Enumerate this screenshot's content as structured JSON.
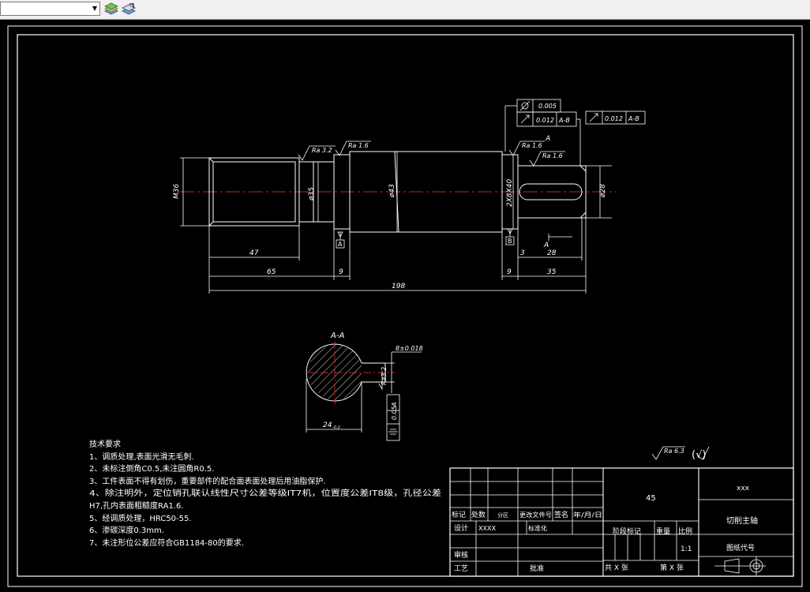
{
  "toolbar": {
    "layer_combo_value": "",
    "icons": [
      "layer-stack-icon",
      "layer-properties-icon"
    ]
  },
  "drawing": {
    "colors": {
      "background": "#000000",
      "line": "#ffffff",
      "center_line": "#ff3333"
    },
    "dims": {
      "m36": "M36",
      "d35": "ø35",
      "d43": "ø43",
      "spline": "2X8X40",
      "d28": "ø28",
      "l47": "47",
      "l65": "65",
      "l9a": "9",
      "l198": "198",
      "l9b": "9",
      "l35": "35",
      "l3": "3",
      "l28": "28"
    },
    "roughness": {
      "ra32": "Ra 3.2",
      "ra16a": "Ra 1.6",
      "ra16b": "Ra 1.6",
      "ra16c": "Ra 1.6",
      "ra63": "Ra 6.3",
      "ra32b": "Ra3.2"
    },
    "tolerances": {
      "runout1": "0.005",
      "runout2": "0.012",
      "datum_ab": "A-B",
      "runout3": "0.012",
      "datum_ab2": "A-B"
    },
    "labels": {
      "datum_a": "A",
      "datum_b": "B",
      "arrow_a": "A",
      "arrow_a2": "A",
      "section_title": "A-A",
      "keyway_width": "24",
      "keyway_width_sub": "-0.2",
      "keyway_tol": "8±0.018",
      "sym_tol": "0.05",
      "sym_datum": "A",
      "ra_check": "(√)"
    },
    "tech_req": {
      "title": "技术要求",
      "items": [
        "1、调质处理,表面光滑无毛刺.",
        "2、未标注倒角C0.5,未注圆角R0.5.",
        "3、工件表面不得有划伤，重要部件的配合面表面处理后用油脂保护.",
        "4、除注明外，定位销孔联认线性尺寸公差等级IT7机，位置度公差IT8级，孔径公差",
        "H7,孔内表面粗糙度RA1.6.",
        "5、经调质处理，HRC50-55.",
        "6、渗碳深度0.3mm.",
        "7、未注形位公差应符合GB1184-80的要求."
      ]
    },
    "title_block": {
      "material": "45",
      "company": "xxx",
      "part_name": "切削主轴",
      "drawing_no_label": "图纸代号",
      "row_headers": [
        "标记",
        "处数",
        "分区",
        "更改文件号",
        "签名",
        "年/月/日"
      ],
      "design": "设计",
      "design_name": "XXXX",
      "standardize": "标准化",
      "stage_mark": "阶段标记",
      "weight": "重量",
      "ratio": "比例",
      "ratio_value": "1:1",
      "review": "审核",
      "process": "工艺",
      "approve": "批准",
      "total_sheets": "共 X 张",
      "sheet_no": "第 X 张"
    }
  }
}
